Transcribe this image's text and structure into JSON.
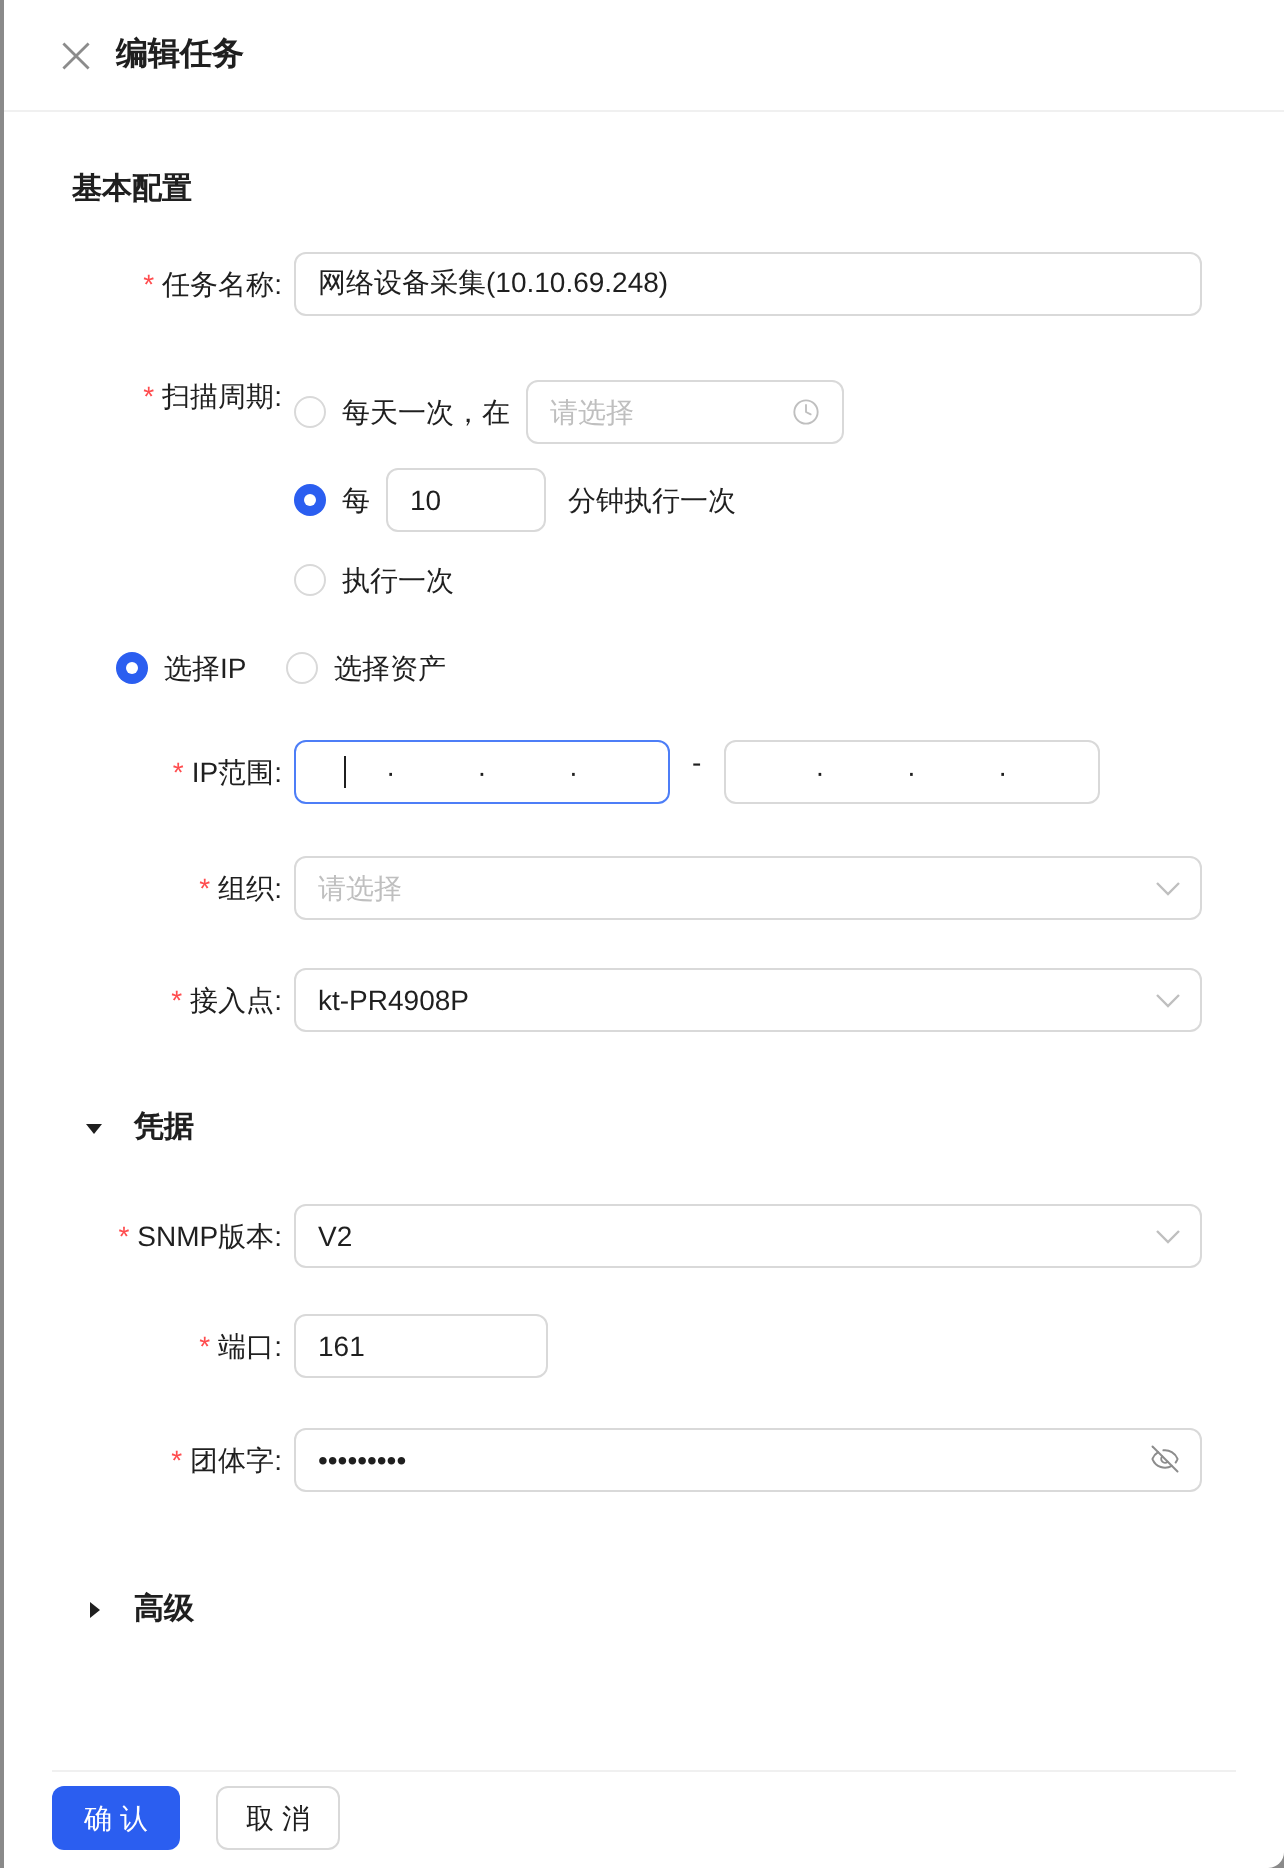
{
  "header": {
    "title": "编辑任务"
  },
  "basic": {
    "title": "基本配置",
    "task_name": {
      "required_mark": "*",
      "label": "任务名称:",
      "value": "网络设备采集(10.10.69.248)"
    },
    "scan_period": {
      "required_mark": "*",
      "label": "扫描周期:",
      "options": [
        {
          "kind": "daily",
          "label": "每天一次，在",
          "placeholder": "请选择",
          "selected": false
        },
        {
          "kind": "interval",
          "label": "每",
          "value": "10",
          "suffix": "分钟执行一次",
          "selected": true
        },
        {
          "kind": "once",
          "label": "执行一次",
          "selected": false
        }
      ]
    },
    "target_mode": [
      {
        "label": "选择IP",
        "selected": true
      },
      {
        "label": "选择资产",
        "selected": false
      }
    ],
    "ip_range": {
      "required_mark": "*",
      "label": "IP范围:",
      "fields": [
        {
          "focused": true,
          "separators": [
            "·",
            "·",
            "·"
          ]
        },
        {
          "focused": false,
          "separators": [
            "·",
            "·",
            "·"
          ]
        }
      ],
      "dash": "-"
    },
    "organization": {
      "required_mark": "*",
      "label": "组织:",
      "placeholder": "请选择"
    },
    "access_point": {
      "required_mark": "*",
      "label": "接入点:",
      "value": "kt-PR4908P"
    }
  },
  "credentials": {
    "title": "凭据",
    "expanded": true,
    "snmp_version": {
      "required_mark": "*",
      "label": "SNMP版本:",
      "value": "V2"
    },
    "port": {
      "required_mark": "*",
      "label": "端口:",
      "value": "161"
    },
    "community": {
      "required_mark": "*",
      "label": "团体字:",
      "value": "•••••••••"
    }
  },
  "advanced": {
    "title": "高级",
    "expanded": false
  },
  "buttons": [
    {
      "kind": "primary",
      "label": "确 认"
    },
    {
      "kind": "default",
      "label": "取 消"
    }
  ]
}
